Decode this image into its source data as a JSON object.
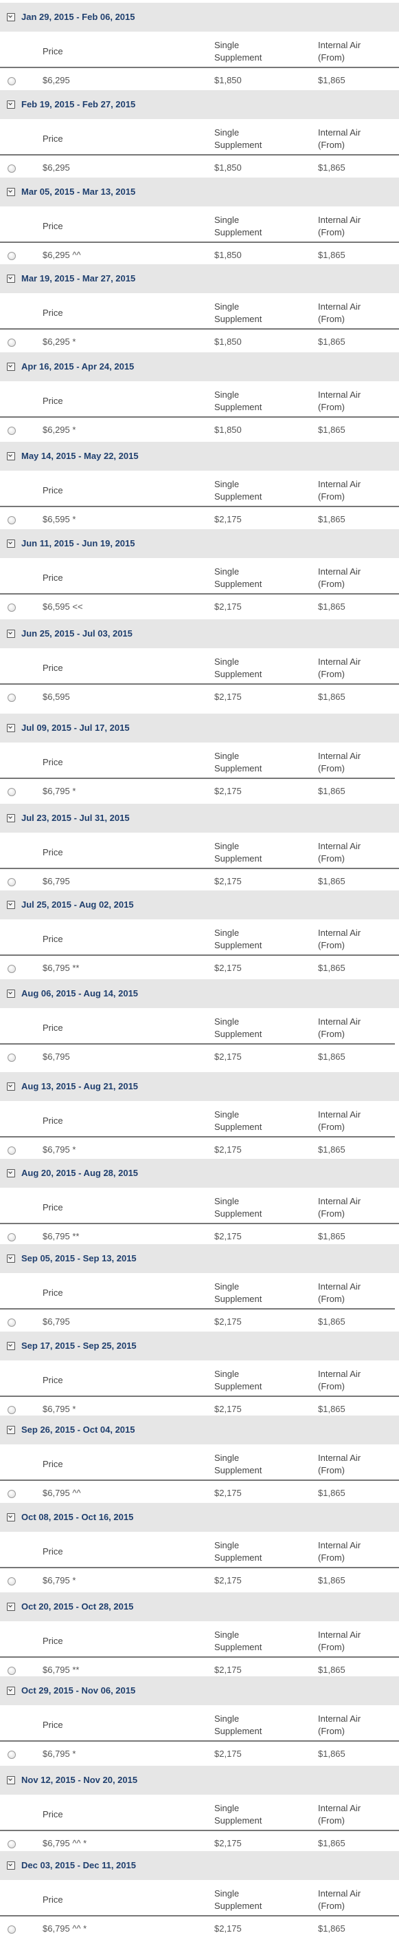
{
  "columns": {
    "price": "Price",
    "single_line1": "Single",
    "single_line2": "Supplement",
    "air_line1": "Internal Air",
    "air_line2": "(From)"
  },
  "departures": [
    {
      "date": "Jan 29, 2015 - Feb 06, 2015",
      "price": "$6,295",
      "single": "$1,850",
      "air": "$1,865"
    },
    {
      "date": "Feb 19, 2015 - Feb 27, 2015",
      "price": "$6,295",
      "single": "$1,850",
      "air": "$1,865"
    },
    {
      "date": "Mar 05, 2015 - Mar 13, 2015",
      "price": "$6,295 ^^",
      "single": "$1,850",
      "air": "$1,865"
    },
    {
      "date": "Mar 19, 2015 - Mar 27, 2015",
      "price": "$6,295 *",
      "single": "$1,850",
      "air": "$1,865"
    },
    {
      "date": "Apr 16, 2015 - Apr 24, 2015",
      "price": "$6,295 *",
      "single": "$1,850",
      "air": "$1,865"
    },
    {
      "date": "May 14, 2015 - May 22, 2015",
      "price": "$6,595 *",
      "single": "$2,175",
      "air": "$1,865"
    },
    {
      "date": "Jun 11, 2015 - Jun 19, 2015",
      "price": "$6,595 <<",
      "single": "$2,175",
      "air": "$1,865"
    },
    {
      "date": "Jun 25, 2015 - Jul 03, 2015",
      "price": "$6,595",
      "single": "$2,175",
      "air": "$1,865"
    },
    {
      "date": "Jul 09, 2015 - Jul 17, 2015",
      "price": "$6,795 *",
      "single": "$2,175",
      "air": "$1,865"
    },
    {
      "date": "Jul 23, 2015 - Jul 31, 2015",
      "price": "$6,795",
      "single": "$2,175",
      "air": "$1,865"
    },
    {
      "date": "Jul 25, 2015 - Aug 02, 2015",
      "price": "$6,795 **",
      "single": "$2,175",
      "air": "$1,865"
    },
    {
      "date": "Aug 06, 2015 - Aug 14, 2015",
      "price": "$6,795",
      "single": "$2,175",
      "air": "$1,865"
    },
    {
      "date": "Aug 13, 2015 - Aug 21, 2015",
      "price": "$6,795 *",
      "single": "$2,175",
      "air": "$1,865"
    },
    {
      "date": "Aug 20, 2015 - Aug 28, 2015",
      "price": "$6,795 **",
      "single": "$2,175",
      "air": "$1,865"
    },
    {
      "date": "Sep 05, 2015 - Sep 13, 2015",
      "price": "$6,795",
      "single": "$2,175",
      "air": "$1,865"
    },
    {
      "date": "Sep 17, 2015 - Sep 25, 2015",
      "price": "$6,795 *",
      "single": "$2,175",
      "air": "$1,865"
    },
    {
      "date": "Sep 26, 2015 - Oct 04, 2015",
      "price": "$6,795 ^^",
      "single": "$2,175",
      "air": "$1,865"
    },
    {
      "date": "Oct 08, 2015 - Oct 16, 2015",
      "price": "$6,795 *",
      "single": "$2,175",
      "air": "$1,865"
    },
    {
      "date": "Oct 20, 2015 - Oct 28, 2015",
      "price": "$6,795 **",
      "single": "$2,175",
      "air": "$1,865"
    },
    {
      "date": "Oct 29, 2015 - Nov 06, 2015",
      "price": "$6,795 *",
      "single": "$2,175",
      "air": "$1,865"
    },
    {
      "date": "Nov 12, 2015 - Nov 20, 2015",
      "price": "$6,795 ^^ *",
      "single": "$2,175",
      "air": "$1,865"
    },
    {
      "date": "Dec 03, 2015 - Dec 11, 2015",
      "price": "$6,795 ^^ *",
      "single": "$2,175",
      "air": "$1,865"
    }
  ]
}
